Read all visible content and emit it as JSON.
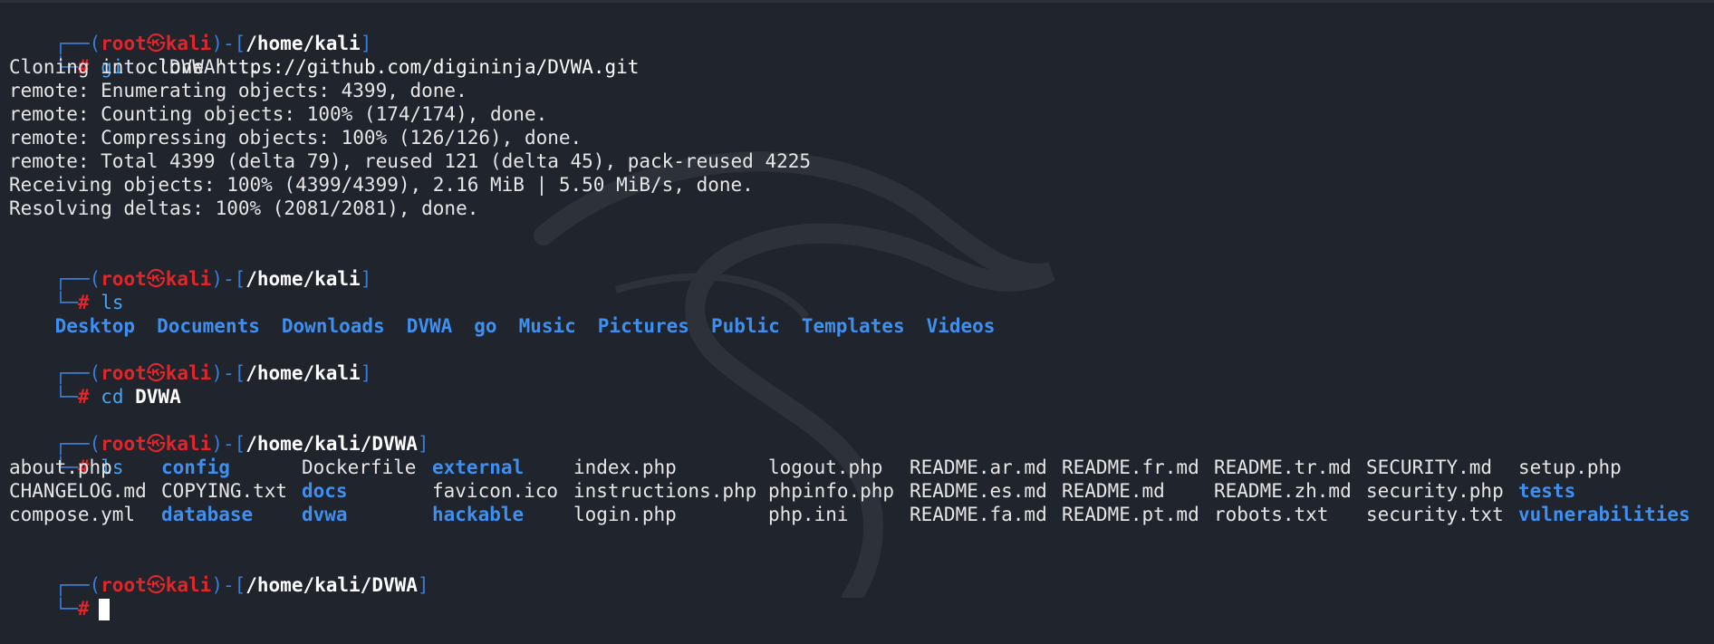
{
  "prompt": {
    "corner_top": "┌──(",
    "corner_bottom": "└─",
    "user": "root",
    "at_symbol": "㉿",
    "host": "kali",
    "sep": ")-[",
    "close": "]",
    "hash": "#"
  },
  "blocks": [
    {
      "path": "/home/kali",
      "command": "git",
      "args": "clone https://github.com/digininja/DVWA.git",
      "output": [
        "Cloning into 'DVWA'...",
        "remote: Enumerating objects: 4399, done.",
        "remote: Counting objects: 100% (174/174), done.",
        "remote: Compressing objects: 100% (126/126), done.",
        "remote: Total 4399 (delta 79), reused 121 (delta 45), pack-reused 4225",
        "Receiving objects: 100% (4399/4399), 2.16 MiB | 5.50 MiB/s, done.",
        "Resolving deltas: 100% (2081/2081), done."
      ]
    },
    {
      "path": "/home/kali",
      "command": "ls",
      "ls_items": [
        "Desktop",
        "Documents",
        "Downloads",
        "DVWA",
        "go",
        "Music",
        "Pictures",
        "Public",
        "Templates",
        "Videos"
      ]
    },
    {
      "path": "/home/kali",
      "command": "cd",
      "args": "DVWA"
    },
    {
      "path": "/home/kali/DVWA",
      "command": "ls",
      "ls_rows": [
        [
          {
            "name": "about.php",
            "dir": false
          },
          {
            "name": "config",
            "dir": true
          },
          {
            "name": "Dockerfile",
            "dir": false
          },
          {
            "name": "external",
            "dir": true
          },
          {
            "name": "index.php",
            "dir": false
          },
          {
            "name": "logout.php",
            "dir": false
          },
          {
            "name": "README.ar.md",
            "dir": false
          },
          {
            "name": "README.fr.md",
            "dir": false
          },
          {
            "name": "README.tr.md",
            "dir": false
          },
          {
            "name": "SECURITY.md",
            "dir": false
          },
          {
            "name": "setup.php",
            "dir": false
          }
        ],
        [
          {
            "name": "CHANGELOG.md",
            "dir": false
          },
          {
            "name": "COPYING.txt",
            "dir": false
          },
          {
            "name": "docs",
            "dir": true
          },
          {
            "name": "favicon.ico",
            "dir": false
          },
          {
            "name": "instructions.php",
            "dir": false
          },
          {
            "name": "phpinfo.php",
            "dir": false
          },
          {
            "name": "README.es.md",
            "dir": false
          },
          {
            "name": "README.md",
            "dir": false
          },
          {
            "name": "README.zh.md",
            "dir": false
          },
          {
            "name": "security.php",
            "dir": false
          },
          {
            "name": "tests",
            "dir": true
          }
        ],
        [
          {
            "name": "compose.yml",
            "dir": false
          },
          {
            "name": "database",
            "dir": true
          },
          {
            "name": "dvwa",
            "dir": true
          },
          {
            "name": "hackable",
            "dir": true
          },
          {
            "name": "login.php",
            "dir": false
          },
          {
            "name": "php.ini",
            "dir": false
          },
          {
            "name": "README.fa.md",
            "dir": false
          },
          {
            "name": "README.pt.md",
            "dir": false
          },
          {
            "name": "robots.txt",
            "dir": false
          },
          {
            "name": "security.txt",
            "dir": false
          },
          {
            "name": "vulnerabilities",
            "dir": true
          }
        ]
      ]
    },
    {
      "path": "/home/kali/DVWA",
      "command": ""
    }
  ],
  "colors": {
    "background": "#20242d",
    "prompt_red": "#e0262a",
    "prompt_box": "#3a7bd5",
    "command_blue": "#4aa3f0",
    "directory_blue": "#3f8ff0"
  }
}
